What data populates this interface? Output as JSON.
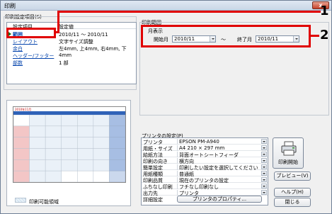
{
  "window": {
    "title": "印刷",
    "close_glyph": "x"
  },
  "settings_group": {
    "label": "印刷設定項目(S)",
    "col_item": "設定項目",
    "col_value": "設定値",
    "rows": [
      {
        "key": "範囲",
        "value": "2010/11 〜 2010/11"
      },
      {
        "key": "レイアウト",
        "value": "文字サイズ調整"
      },
      {
        "key": "余白",
        "value": "左4mm, 上4mm, 右4mm, 下4mm"
      },
      {
        "key": "ヘッダー/フッター",
        "value": ""
      },
      {
        "key": "部数",
        "value": "1 部"
      }
    ]
  },
  "print_range": {
    "label": "印刷範囲",
    "mode_label": "月表示",
    "start_label": "開始月",
    "start_value": "2010/11",
    "tilde": "〜",
    "end_label": "終了月",
    "end_value": "2010/11"
  },
  "preview": {
    "calendar_title": "2010年11月",
    "legend_label": "印刷可能領域",
    "weekend_color": "#f3c6c6",
    "header_color": "#2f62b8"
  },
  "printer_settings": {
    "label": "プリンタの設定(P)",
    "rows": [
      {
        "key": "プリンタ",
        "value": "EPSON PM-A940"
      },
      {
        "key": "用紙・サイズ",
        "value": "A4 210 × 297 mm"
      },
      {
        "key": "給紙方法",
        "value": "背面オートシートフィーダ"
      },
      {
        "key": "印刷の向き",
        "value": "横方向"
      },
      {
        "key": "簡単設定",
        "value": "印刷したい設定を選択してください"
      },
      {
        "key": "用紙種類",
        "value": "普通紙"
      },
      {
        "key": "印刷品質",
        "value": "現在のプリンタの設定"
      },
      {
        "key": "ふちなし印刷",
        "value": "フチなし印刷なし"
      },
      {
        "key": "出力先",
        "value": "プリンタ"
      },
      {
        "key": "詳細設定",
        "value": "プリンタのプロパティ..."
      }
    ]
  },
  "buttons": {
    "print": "印刷開始",
    "preview": "プレビュー(V)",
    "help": "ヘルプ(H)",
    "close": "閉じる"
  },
  "callouts": {
    "one": "1",
    "two": "2"
  }
}
